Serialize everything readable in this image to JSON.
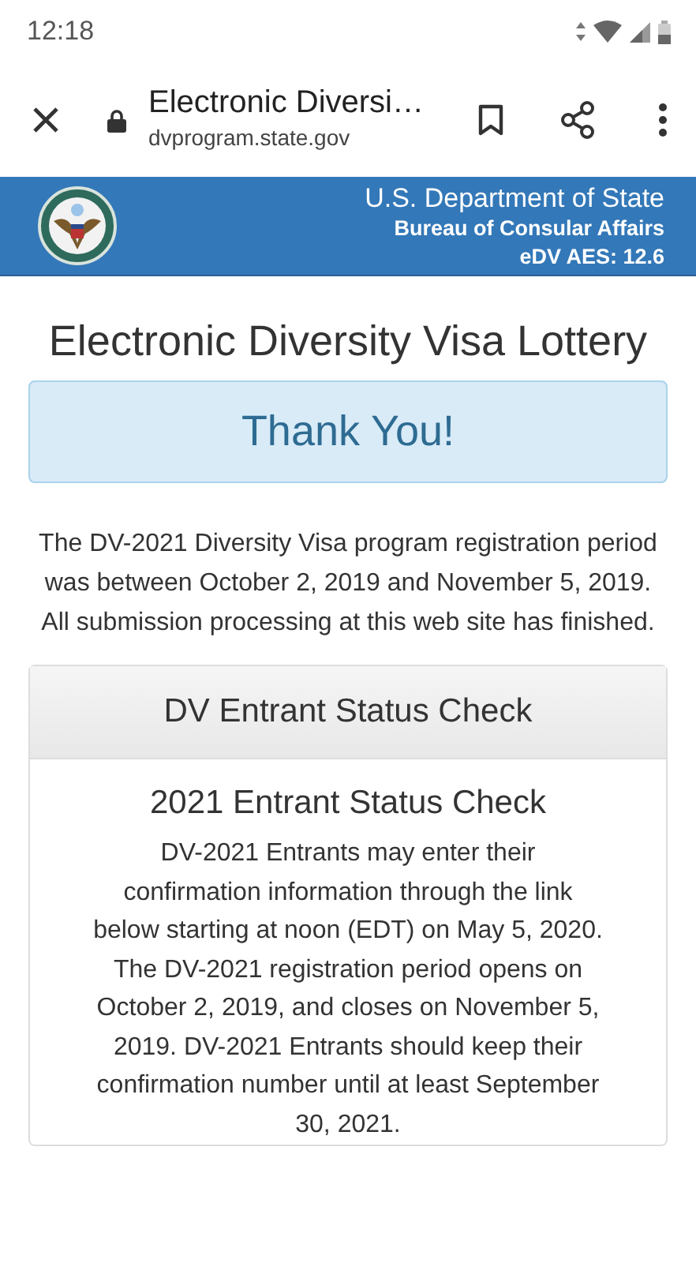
{
  "status_bar": {
    "time": "12:18"
  },
  "browser": {
    "title": "Electronic Diversi…",
    "url": "dvprogram.state.gov"
  },
  "site_header": {
    "department": "U.S. Department of State",
    "bureau": "Bureau of Consular Affairs",
    "version": "eDV AES: 12.6"
  },
  "page_title": "Electronic Diversity Visa Lottery",
  "alert": "Thank You!",
  "intro": "The DV-2021 Diversity Visa program registration period was between October 2, 2019 and November 5, 2019. All submission processing at this web site has finished.",
  "card": {
    "header": "DV Entrant Status Check",
    "heading": "2021 Entrant Status Check",
    "body": "DV-2021 Entrants may enter their confirmation information through the link below starting at noon (EDT) on May 5, 2020. The DV-2021 registration period opens on October 2, 2019, and closes on November 5, 2019. DV-2021 Entrants should keep their confirmation number until at least September 30, 2021."
  }
}
